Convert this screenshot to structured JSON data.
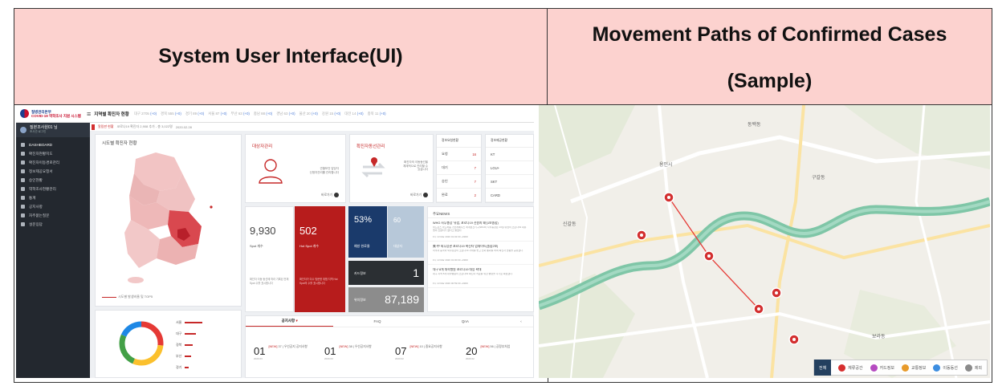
{
  "table": {
    "header_left": "System User Interface(UI)",
    "header_right_line1": "Movement Paths of Confirmed Cases",
    "header_right_line2": "(Sample)"
  },
  "dashboard": {
    "logo_line1": "질병관리본부",
    "logo_line2": "COVID-19 역학조사 지원 시스템",
    "title": "지역별 확진자 현황",
    "stats": [
      {
        "label": "대구 2705",
        "delta": "(+0)"
      },
      {
        "label": "경북 555",
        "delta": "(+0)"
      },
      {
        "label": "경기 89",
        "delta": "(+0)"
      },
      {
        "label": "서울 87",
        "delta": "(+0)"
      },
      {
        "label": "부산 63",
        "delta": "(+0)"
      },
      {
        "label": "충남 88",
        "delta": "(+0)"
      },
      {
        "label": "경남 63",
        "delta": "(+0)"
      },
      {
        "label": "울산 20",
        "delta": "(+0)"
      },
      {
        "label": "강원 15",
        "delta": "(+0)"
      },
      {
        "label": "대전 14",
        "delta": "(+0)"
      },
      {
        "label": "충북 11",
        "delta": "(+0)"
      }
    ],
    "user_name": "질본조사원01 님",
    "user_sub": "조사관 로그인",
    "side_menu": [
      "DASHBOARD",
      "확진자현황지도",
      "확진자이동경로관리",
      "정보제공요청서",
      "승인현황",
      "역학조사현황관리",
      "통계",
      "공지사항",
      "자주묻는질문",
      "설문응답"
    ],
    "crumb_tag": "알림판 현황",
    "crumb_text": "코로나19 확진자 2,908 추가 - 총 3,022명",
    "crumb_date": "2020.02.28",
    "map_title": "시도별 확진자 현황",
    "map_legend": "시도별 발생비율 및 TOP5",
    "regions": [
      {
        "name": "서울",
        "bar": 22
      },
      {
        "name": "대구",
        "bar": 14
      },
      {
        "name": "경북",
        "bar": 10
      },
      {
        "name": "부산",
        "bar": 8
      },
      {
        "name": "경기",
        "bar": 5
      }
    ],
    "manager": {
      "title": "대상자관리",
      "desc1": "관할보건 담당자",
      "desc2": "신청자관리를 관리합니다",
      "more": "바로가기"
    },
    "movement": {
      "title": "확진자동선관리",
      "desc1": "확진자의 이동동선을",
      "desc2": "체계적으로 관리할 수",
      "desc3": "있습니다",
      "more": "바로가기"
    },
    "stat_table": {
      "head": "정보요청현황",
      "rows": [
        {
          "label": "요청",
          "value": "16"
        },
        {
          "label": "대기",
          "value": "7"
        },
        {
          "label": "승인",
          "value": "7"
        },
        {
          "label": "완료",
          "value": "2"
        }
      ]
    },
    "agency_table": {
      "head": "정보제공현황",
      "rows": [
        "KT",
        "LGU+",
        "SKT",
        "CARD"
      ]
    },
    "spot": {
      "number": "9,930",
      "label": "Spot 개수",
      "desc": "확진자 이동 동선에 따라 기록된 전체 Spot 수를 표시합니다"
    },
    "hotspot": {
      "number": "502",
      "label": "Hot Spot 개수",
      "desc": "확진자가 다수 방문한 위험 지역 Hot Spot의 수를 표시합니다"
    },
    "pct": {
      "number": "53%",
      "label": "예방 완료율"
    },
    "pct2": {
      "number": "60",
      "label": "대상자"
    },
    "card_info": {
      "label": "카드정보",
      "number": "1"
    },
    "card_total": {
      "label": "위치정보",
      "number": "87,189"
    },
    "news": {
      "head": "주요NEWS",
      "items": [
        {
          "title": "WHO 사무총장 '유럽, 코로나19 진원지 돼'(1보종합)",
          "body": "테드로스 아드하놈 거브레예수스 세계보건기구(WHO) 사무총장은 13일 유럽이 코로나19 대유행의 진원지가 됐다고 밝혔다.",
          "date": "Fri, 13 Mar 2020 01:02:00 +0900"
        },
        {
          "title": "美·中 외무장관 코로나19 확진자 업데이트(종합2보)",
          "body": "미국과 중국의 외무장관이 코로나19 사태를 놓고 전화 통화를 하며 확진자 현황을 공유했다.",
          "date": "Fri, 13 Mar 2020 01:00:00 +0900"
        },
        {
          "title": "대구 8개 대학병원 코로나19 대응 확대",
          "body": "대구 지역 8개 대학병원이 코로나19 확진자 치료를 위한 병상을 추가로 확보했다.",
          "date": "Fri, 13 Mar 2020 00:59:00 +0900"
        }
      ]
    },
    "board": {
      "tabs": [
        "공지사항",
        "FAQ",
        "QnA"
      ],
      "tab_arrow": "▾",
      "tab_next": "‹",
      "items": [
        {
          "day": "01",
          "new": "[NEW]",
          "text": "37 | 우선공지 공지사항",
          "date": "2020.03"
        },
        {
          "day": "01",
          "new": "[NEW]",
          "text": "38 | 우선공지사항",
          "date": "2020.03"
        },
        {
          "day": "07",
          "new": "[NEW]",
          "text": "10 | 중요공지사항",
          "date": "2020.02"
        },
        {
          "day": "20",
          "new": "[NEW]",
          "text": "56 | 공정부처업",
          "date": "2020.02"
        }
      ]
    }
  },
  "route_map": {
    "legend_all": "전체",
    "legend_items": [
      {
        "label": "체류공간",
        "color": "#d62e2e"
      },
      {
        "label": "카드정보",
        "color": "#b54bc0"
      },
      {
        "label": "교통정보",
        "color": "#e89b2b"
      },
      {
        "label": "이동동선",
        "color": "#3c8de0"
      },
      {
        "label": "제외",
        "color": "#8a8a8a"
      }
    ],
    "place_labels": [
      "용인시",
      "동백동",
      "신갈동",
      "구갈동",
      "보라동"
    ]
  }
}
